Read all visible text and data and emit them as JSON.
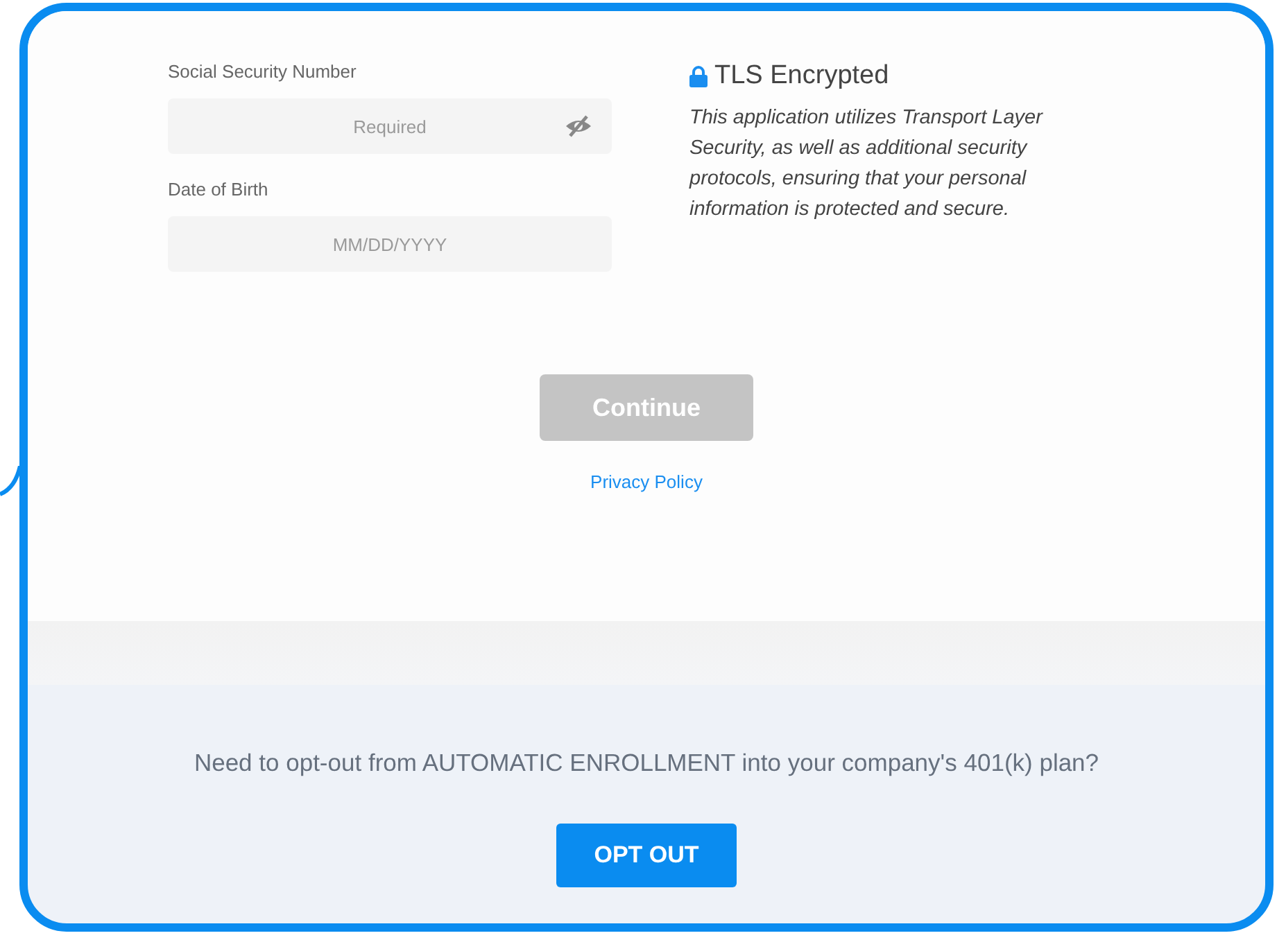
{
  "fields": [
    {
      "label": "Social Security Number",
      "placeholder": "Required",
      "kind": "secret"
    },
    {
      "label": "Date of Birth",
      "placeholder": "MM/DD/YYYY",
      "kind": "date"
    }
  ],
  "security": {
    "title": "TLS Encrypted",
    "text": "This application utilizes Transport Layer Security, as well as additional security protocols, ensuring that your personal information is protected and secure."
  },
  "continue_button": {
    "label": "Continue",
    "disabled": true
  },
  "privacy_link": "Privacy Policy",
  "opt_out": {
    "question": "Need to opt-out from AUTOMATIC ENROLLMENT into your company's 401(k) plan?",
    "button": "OPT OUT"
  }
}
